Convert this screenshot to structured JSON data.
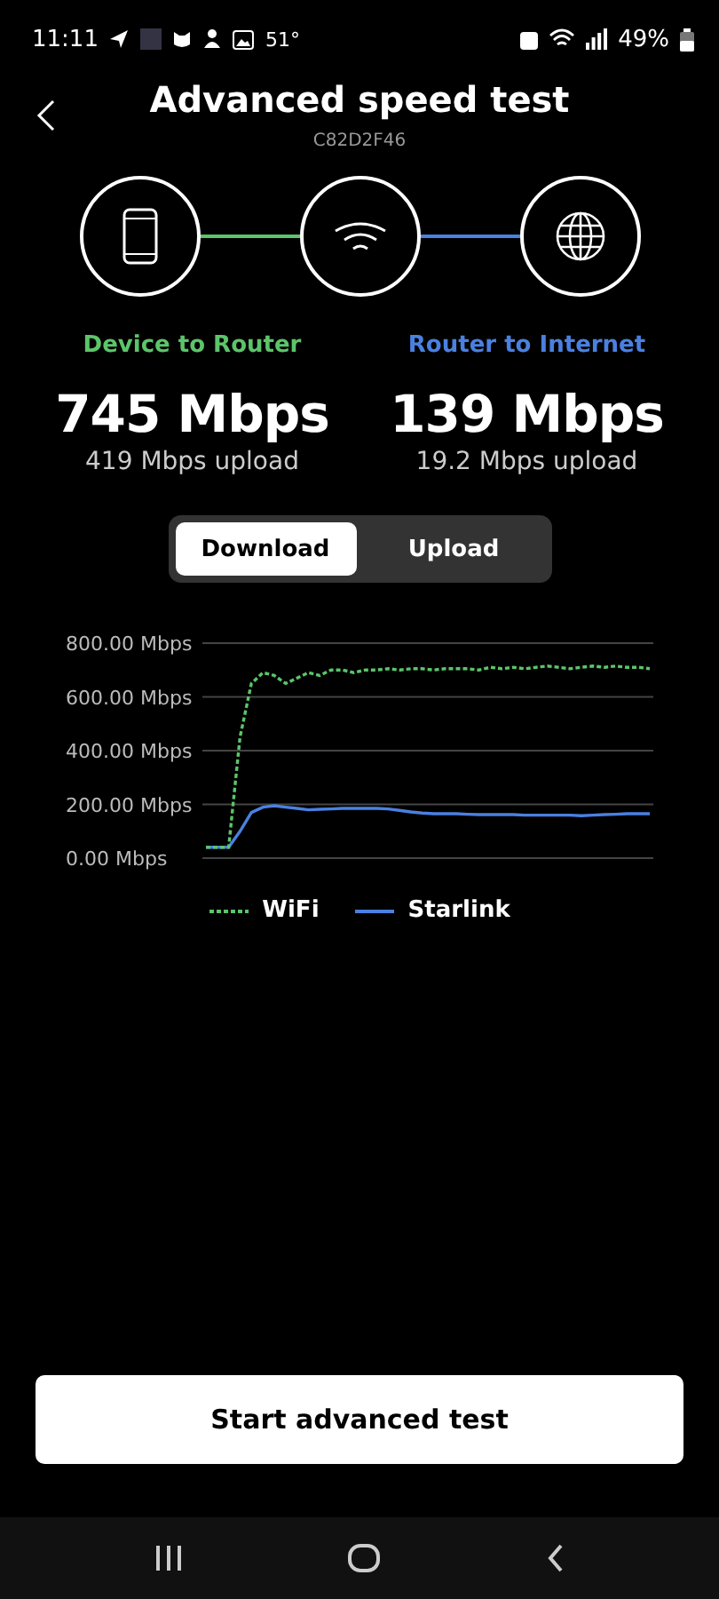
{
  "status_bar": {
    "time": "11:11",
    "temperature": "51°",
    "battery": "49%"
  },
  "header": {
    "title": "Advanced speed test",
    "subtitle": "C82D2F46"
  },
  "links": [
    {
      "color": "#5cc46a"
    },
    {
      "color": "#4a80e0"
    }
  ],
  "results": [
    {
      "label": "Device to Router",
      "color": "#5cc46a",
      "speed": "745 Mbps",
      "upload": "419 Mbps upload"
    },
    {
      "label": "Router to Internet",
      "color": "#4a80e0",
      "speed": "139 Mbps",
      "upload": "19.2 Mbps upload"
    }
  ],
  "tabs": [
    {
      "label": "Download",
      "selected": true
    },
    {
      "label": "Upload",
      "selected": false
    }
  ],
  "chart_data": {
    "type": "line",
    "grid": true,
    "legend": true,
    "ylim": [
      0,
      800
    ],
    "yticks": [
      {
        "value": 0,
        "label": "0.00 Mbps"
      },
      {
        "value": 200,
        "label": "200.00 Mbps"
      },
      {
        "value": 400,
        "label": "400.00 Mbps"
      },
      {
        "value": 600,
        "label": "600.00 Mbps"
      },
      {
        "value": 800,
        "label": "800.00 Mbps"
      }
    ],
    "series": [
      {
        "name": "WiFi",
        "color": "#5cc46a",
        "line_style": "dashed",
        "values": [
          40,
          40,
          40,
          450,
          650,
          690,
          680,
          650,
          670,
          690,
          680,
          700,
          700,
          690,
          700,
          700,
          705,
          700,
          705,
          705,
          700,
          705,
          705,
          705,
          700,
          710,
          705,
          710,
          705,
          710,
          715,
          710,
          705,
          710,
          715,
          710,
          715,
          710,
          710,
          705
        ]
      },
      {
        "name": "Starlink",
        "color": "#4a80e0",
        "line_style": "solid",
        "values": [
          40,
          40,
          40,
          100,
          170,
          190,
          195,
          190,
          185,
          180,
          182,
          183,
          185,
          185,
          185,
          185,
          183,
          178,
          172,
          168,
          165,
          165,
          165,
          163,
          162,
          162,
          162,
          162,
          160,
          160,
          160,
          160,
          160,
          158,
          160,
          162,
          163,
          165,
          165,
          165
        ]
      }
    ]
  },
  "start_button": "Start advanced test"
}
